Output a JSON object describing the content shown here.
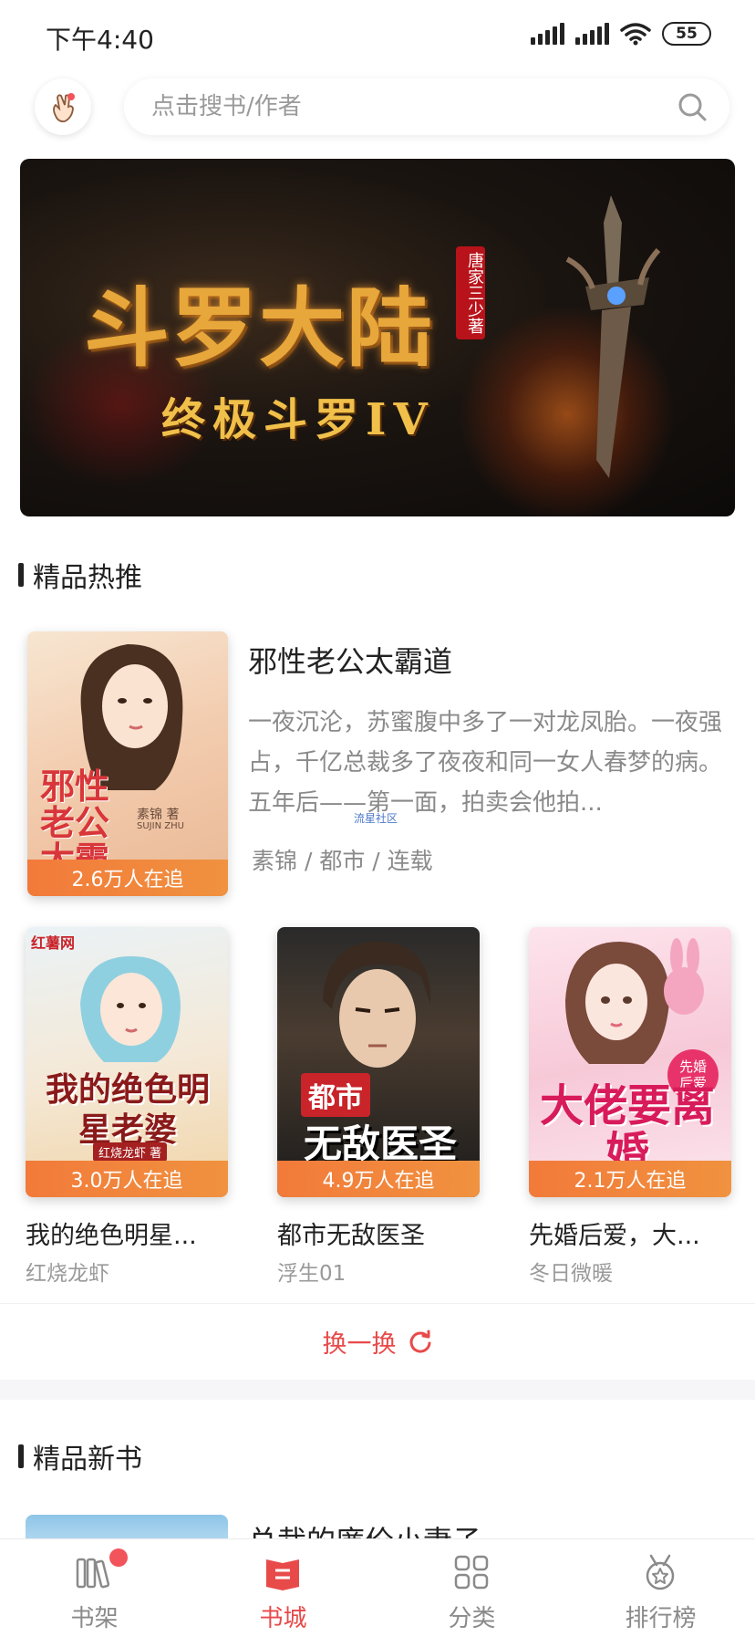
{
  "status_bar": {
    "time": "下午4:40",
    "battery": "55"
  },
  "search": {
    "placeholder": "点击搜书/作者",
    "avatar_icon": "hand-gesture-icon",
    "search_icon": "search-icon"
  },
  "banner": {
    "title": "斗罗大陆",
    "subtitle": "终极斗罗IV",
    "author": "唐家三少著"
  },
  "sections": {
    "hot": "精品热推",
    "new": "精品新书"
  },
  "featured": {
    "title": "邪性老公太霸道",
    "description": "一夜沉沦，苏蜜腹中多了一对龙凤胎。一夜强占，千亿总裁多了夜夜和同一女人春梦的病。五年后——第一面，拍卖会他拍...",
    "meta": "素锦 / 都市 / 连载",
    "followers": "2.6万人在追",
    "cover_text": "邪性老公太霸道",
    "cover_author": "素锦 著",
    "cover_author_en": "SUJIN ZHU"
  },
  "watermark": "流星社区",
  "grid": [
    {
      "title": "我的绝色明星...",
      "author": "红烧龙虾",
      "followers": "3.0万人在追",
      "cover_text": "我的绝色明星老婆",
      "cover_badge": "红薯网",
      "cover_tag": "红烧龙虾 著"
    },
    {
      "title": "都市无敌医圣",
      "author": "浮生01",
      "followers": "4.9万人在追",
      "cover_text_a": "都市",
      "cover_text_b": "无敌医圣"
    },
    {
      "title": "先婚后爱，大...",
      "author": "冬日微暖",
      "followers": "2.1万人在追",
      "cover_text": "大佬要离婚",
      "cover_tag": "先婚后爱"
    }
  ],
  "refresh": {
    "label": "换一换",
    "icon": "refresh-icon"
  },
  "new_preview": {
    "title": "总裁的廉价小妻子"
  },
  "nav": [
    {
      "label": "书架",
      "icon": "bookshelf-icon",
      "active": false,
      "badge": true
    },
    {
      "label": "书城",
      "icon": "book-open-icon",
      "active": true,
      "badge": false
    },
    {
      "label": "分类",
      "icon": "grid-icon",
      "active": false,
      "badge": false
    },
    {
      "label": "排行榜",
      "icon": "medal-icon",
      "active": false,
      "badge": false
    }
  ],
  "colors": {
    "accent": "#e84a4a",
    "follow_bar": "#f27a3a",
    "text_primary": "#222222",
    "text_secondary": "#8a8a8a"
  }
}
